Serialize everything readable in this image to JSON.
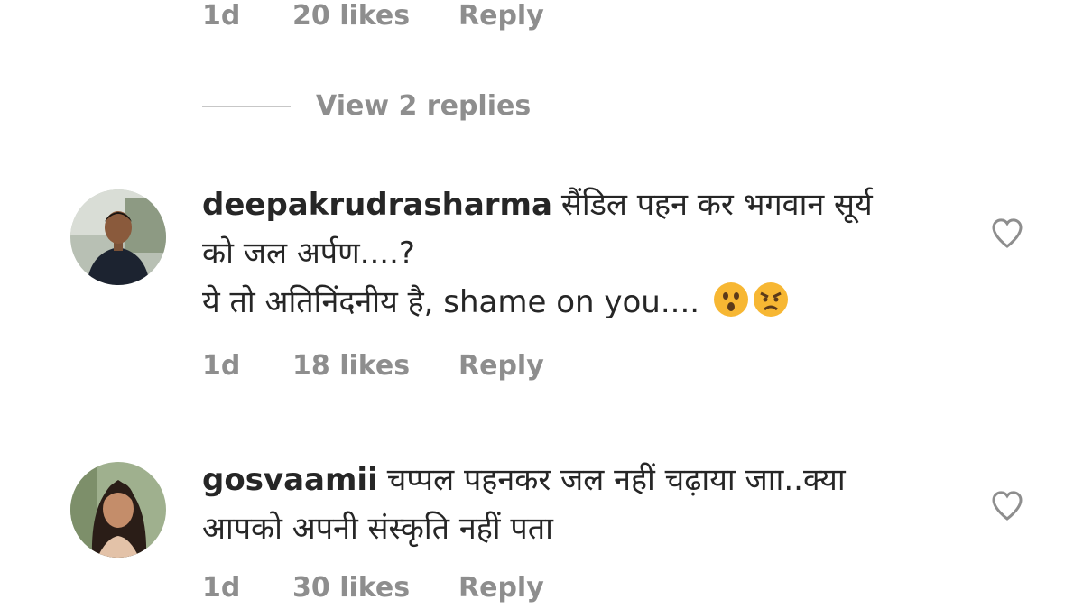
{
  "comments": [
    {
      "username": "",
      "text_lines": [],
      "time": "1d",
      "likes": "20 likes",
      "reply_label": "Reply",
      "view_replies": "View 2 replies"
    },
    {
      "username": "deepakrudrasharma",
      "text_line1": "सैंडिल पहन कर भगवान सूर्य",
      "text_line2": "को जल अर्पण....?",
      "text_line3": "ये तो अतिनिंदनीय है, shame on you....",
      "emojis": [
        "hushed-face",
        "angry-face"
      ],
      "time": "1d",
      "likes": "18 likes",
      "reply_label": "Reply"
    },
    {
      "username": "gosvaamii",
      "text_line1": "चप्पल पहनकर  जल नहीं चढ़ाया जाा..क्या",
      "text_line2": "आपको अपनी संस्कृति नहीं पता",
      "time": "1d",
      "likes": "30 likes",
      "reply_label": "Reply"
    }
  ],
  "colors": {
    "text": "#262626",
    "meta": "#8e8e8e",
    "divider": "#c7c7c7",
    "heart": "#8e8e8e",
    "emoji_face": "#f7b733"
  }
}
